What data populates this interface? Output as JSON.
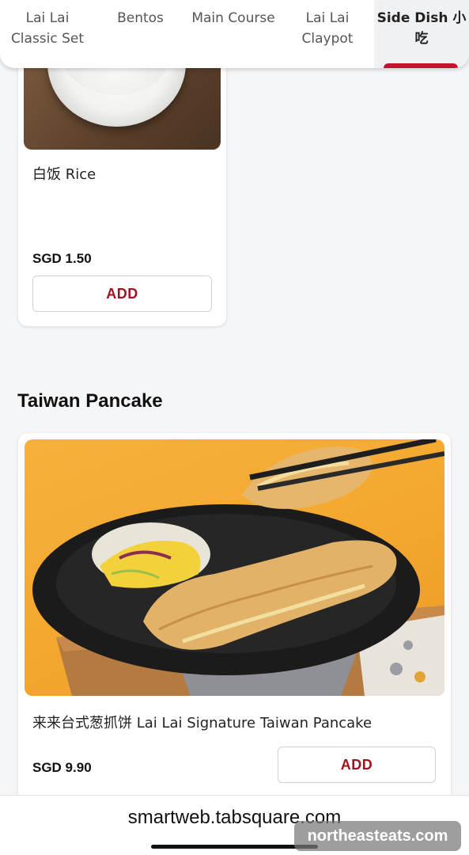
{
  "tabs": [
    {
      "label": "Lai Lai\nClassic Set"
    },
    {
      "label": "Bentos"
    },
    {
      "label": "Main Course"
    },
    {
      "label": "Lai Lai\nClaypot"
    },
    {
      "label": "Side Dish 小\n吃",
      "active": true
    }
  ],
  "items": {
    "rice": {
      "name": "白饭 Rice",
      "price": "SGD 1.50",
      "add_label": "ADD"
    },
    "pancake": {
      "name": "来来台式葱抓饼 Lai Lai Signature Taiwan Pancake",
      "price": "SGD 9.90",
      "add_label": "ADD"
    }
  },
  "sections": {
    "taiwan_pancake": "Taiwan Pancake"
  },
  "browser": {
    "url": "smartweb.tabsquare.com"
  },
  "watermark": "northeasteats.com",
  "colors": {
    "accent": "#c8102e",
    "add_text": "#a3111e"
  }
}
